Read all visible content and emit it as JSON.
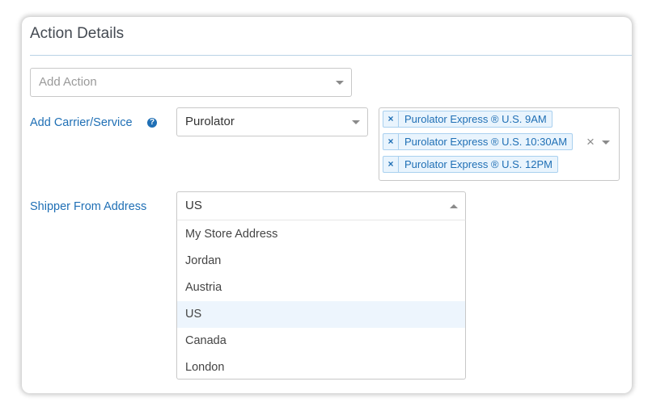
{
  "card": {
    "title": "Action Details"
  },
  "add_action": {
    "placeholder": "Add Action"
  },
  "carrier": {
    "label": "Add Carrier/Service",
    "help_icon": "question-circle-icon",
    "selected": "Purolator",
    "services": [
      {
        "label": "Purolator Express ® U.S. 9AM"
      },
      {
        "label": "Purolator Express ® U.S. 10:30AM"
      },
      {
        "label": "Purolator Express ® U.S. 12PM"
      }
    ],
    "tag_remove_glyph": "×",
    "clear_all_glyph": "×"
  },
  "shipper": {
    "label": "Shipper From Address",
    "selected": "US",
    "options": [
      {
        "label": "My Store Address"
      },
      {
        "label": "Jordan"
      },
      {
        "label": "Austria"
      },
      {
        "label": "US",
        "selected": true
      },
      {
        "label": "Canada"
      },
      {
        "label": "London"
      }
    ]
  },
  "colors": {
    "accent": "#1f6fb5",
    "tag_bg": "#e9f4fd",
    "tag_border": "#a9d0ef",
    "selected_row": "#edf5fd"
  }
}
